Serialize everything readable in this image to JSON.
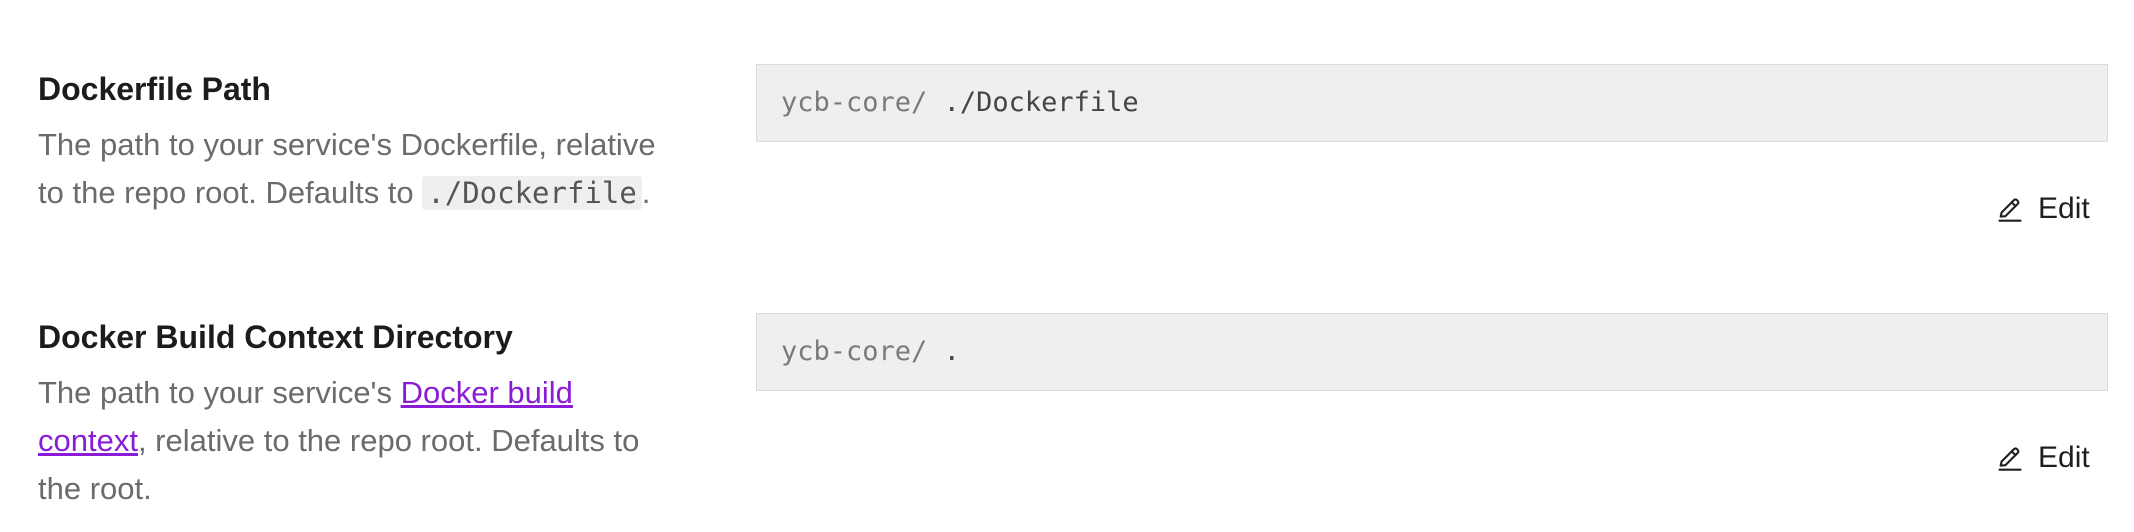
{
  "sections": [
    {
      "title": "Dockerfile Path",
      "description": {
        "text_before": "The path to your service's Dockerfile, relative to the repo root. Defaults to ",
        "code": "./Dockerfile",
        "text_after": "."
      },
      "field": {
        "prefix": "ycb-core/",
        "value": "./Dockerfile"
      },
      "edit_label": "Edit"
    },
    {
      "title": "Docker Build Context Directory",
      "description": {
        "text_before": "The path to your service's ",
        "link": "Docker build context",
        "text_after": ", relative to the repo root. Defaults to the root."
      },
      "field": {
        "prefix": "ycb-core/",
        "value": "."
      },
      "edit_label": "Edit"
    }
  ],
  "colors": {
    "link": "#8a1cd8",
    "field_bg": "#efefef",
    "description": "#6b6b6b"
  },
  "icons": {
    "edit": "pencil-icon"
  }
}
